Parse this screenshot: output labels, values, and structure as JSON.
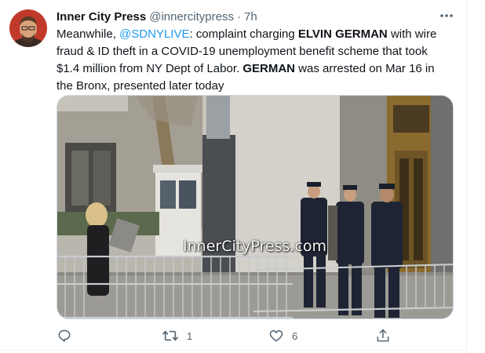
{
  "tweet": {
    "author_name": "Inner City Press",
    "handle": "@innercitypress",
    "separator": "·",
    "timestamp": "7h",
    "text": {
      "l1_a": "Meanwhile, ",
      "l1_mention": "@SDNYLIVE",
      "l1_b": ": complaint charging ",
      "l1_bold": "ELVIN GERMAN",
      "l1_c": " with wire",
      "l2": "fraud & ID theft in a COVID-19 unemployment benefit scheme that took",
      "l3_a": "$1.4 million from NY Dept of Labor. ",
      "l3_bold": "GERMAN",
      "l3_b": " was arrested on Mar 16 in",
      "l4": "the Bronx, presented later today"
    },
    "media": {
      "watermark": "InnerCityPress.com"
    },
    "actions": {
      "reply_count": "",
      "retweet_count": "1",
      "like_count": "6"
    }
  },
  "icons": {
    "more": "more-horizontal-icon",
    "reply": "reply-icon",
    "retweet": "retweet-icon",
    "like": "heart-icon",
    "share": "share-icon"
  },
  "colors": {
    "accent": "#1d9bf0",
    "text": "#0f1419",
    "secondary": "#536471"
  }
}
